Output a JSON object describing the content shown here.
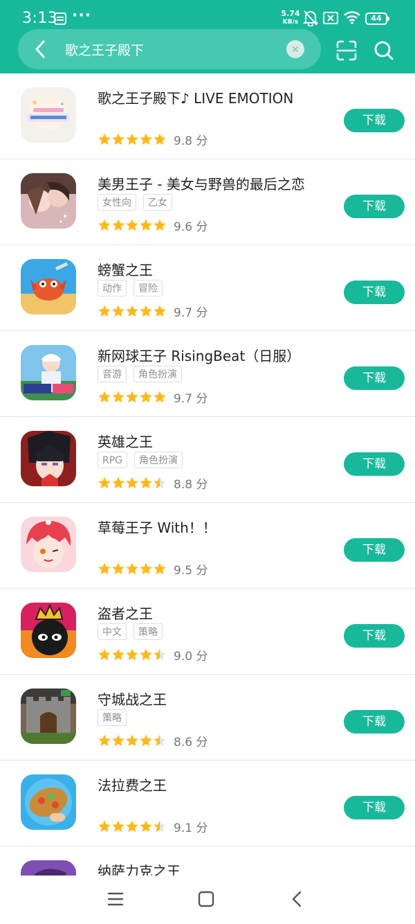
{
  "status_bar": {
    "time": "3:13",
    "dots": "···",
    "net_speed_value": "5.74",
    "net_speed_unit": "KB/s",
    "battery": "44"
  },
  "search": {
    "query": "歌之王子殿下"
  },
  "colors": {
    "brand": "#18b99a",
    "star": "#ffb819",
    "star_empty": "#e3e3e3"
  },
  "apps": [
    {
      "name": "歌之王子殿下♪ LIVE EMOTION",
      "tags": [],
      "rating": 5,
      "score": "9.8 分",
      "button": "下载"
    },
    {
      "name": "美男王子 - 美女与野兽的最后之恋",
      "tags": [
        "女性向",
        "乙女"
      ],
      "rating": 5,
      "score": "9.6 分",
      "button": "下载"
    },
    {
      "name": "螃蟹之王",
      "tags": [
        "动作",
        "冒险"
      ],
      "rating": 5,
      "score": "9.7 分",
      "button": "下载"
    },
    {
      "name": "新网球王子 RisingBeat（日服）",
      "tags": [
        "音游",
        "角色扮演"
      ],
      "rating": 5,
      "score": "9.7 分",
      "button": "下载"
    },
    {
      "name": "英雄之王",
      "tags": [
        "RPG",
        "角色扮演"
      ],
      "rating": 4.5,
      "score": "8.8 分",
      "button": "下载"
    },
    {
      "name": "草莓王子 With！！",
      "tags": [],
      "rating": 5,
      "score": "9.5 分",
      "button": "下载"
    },
    {
      "name": "盗者之王",
      "tags": [
        "中文",
        "策略"
      ],
      "rating": 4.5,
      "score": "9.0 分",
      "button": "下载"
    },
    {
      "name": "守城战之王",
      "tags": [
        "策略"
      ],
      "rating": 4.5,
      "score": "8.6 分",
      "button": "下载"
    },
    {
      "name": "法拉费之王",
      "tags": [],
      "rating": 4.5,
      "score": "9.1 分",
      "button": "下载"
    },
    {
      "name": "纳萨力克之王",
      "tags": [],
      "rating": 0,
      "score": "",
      "button": ""
    }
  ],
  "icons": [
    "back-arrow",
    "clear-x",
    "scan-frame",
    "magnifier",
    "menu-lines",
    "home-square",
    "back-chevron",
    "star"
  ]
}
